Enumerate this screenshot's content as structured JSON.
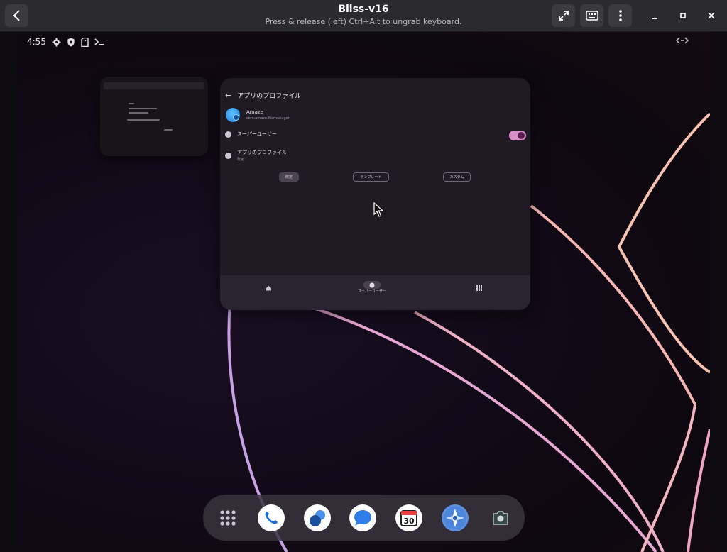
{
  "window": {
    "title": "Bliss-v16",
    "subtitle": "Press & release (left) Ctrl+Alt to ungrab keyboard."
  },
  "statusbar": {
    "time": "4:55",
    "icons": [
      "gear-icon",
      "shield-icon",
      "sd-card-icon",
      "terminal-icon"
    ],
    "right_icon": "code-arrows-icon"
  },
  "recent_card": {
    "header_title": "アプリのプロファイル",
    "app": {
      "name": "Amaze",
      "package": "com.amaze.filemanager"
    },
    "rows": {
      "superuser_label": "スーパーユーザー",
      "profile_label": "アプリのプロファイル",
      "profile_sub": "既定"
    },
    "superuser_toggle_on": true,
    "segments": {
      "default": "既定",
      "template": "テンプレート",
      "custom": "カスタム"
    },
    "bottom_nav": {
      "superuser": "スーパーユーザー"
    }
  },
  "dock": {
    "items": [
      "app-drawer-icon",
      "phone-icon",
      "contacts-icon",
      "messages-icon",
      "calendar-icon",
      "browser-icon",
      "camera-icon"
    ],
    "calendar_day": "30"
  },
  "colors": {
    "titlebar": "#2b2a2e",
    "toggle_accent": "#d78fc9",
    "card_bg": "#1f1a24"
  }
}
